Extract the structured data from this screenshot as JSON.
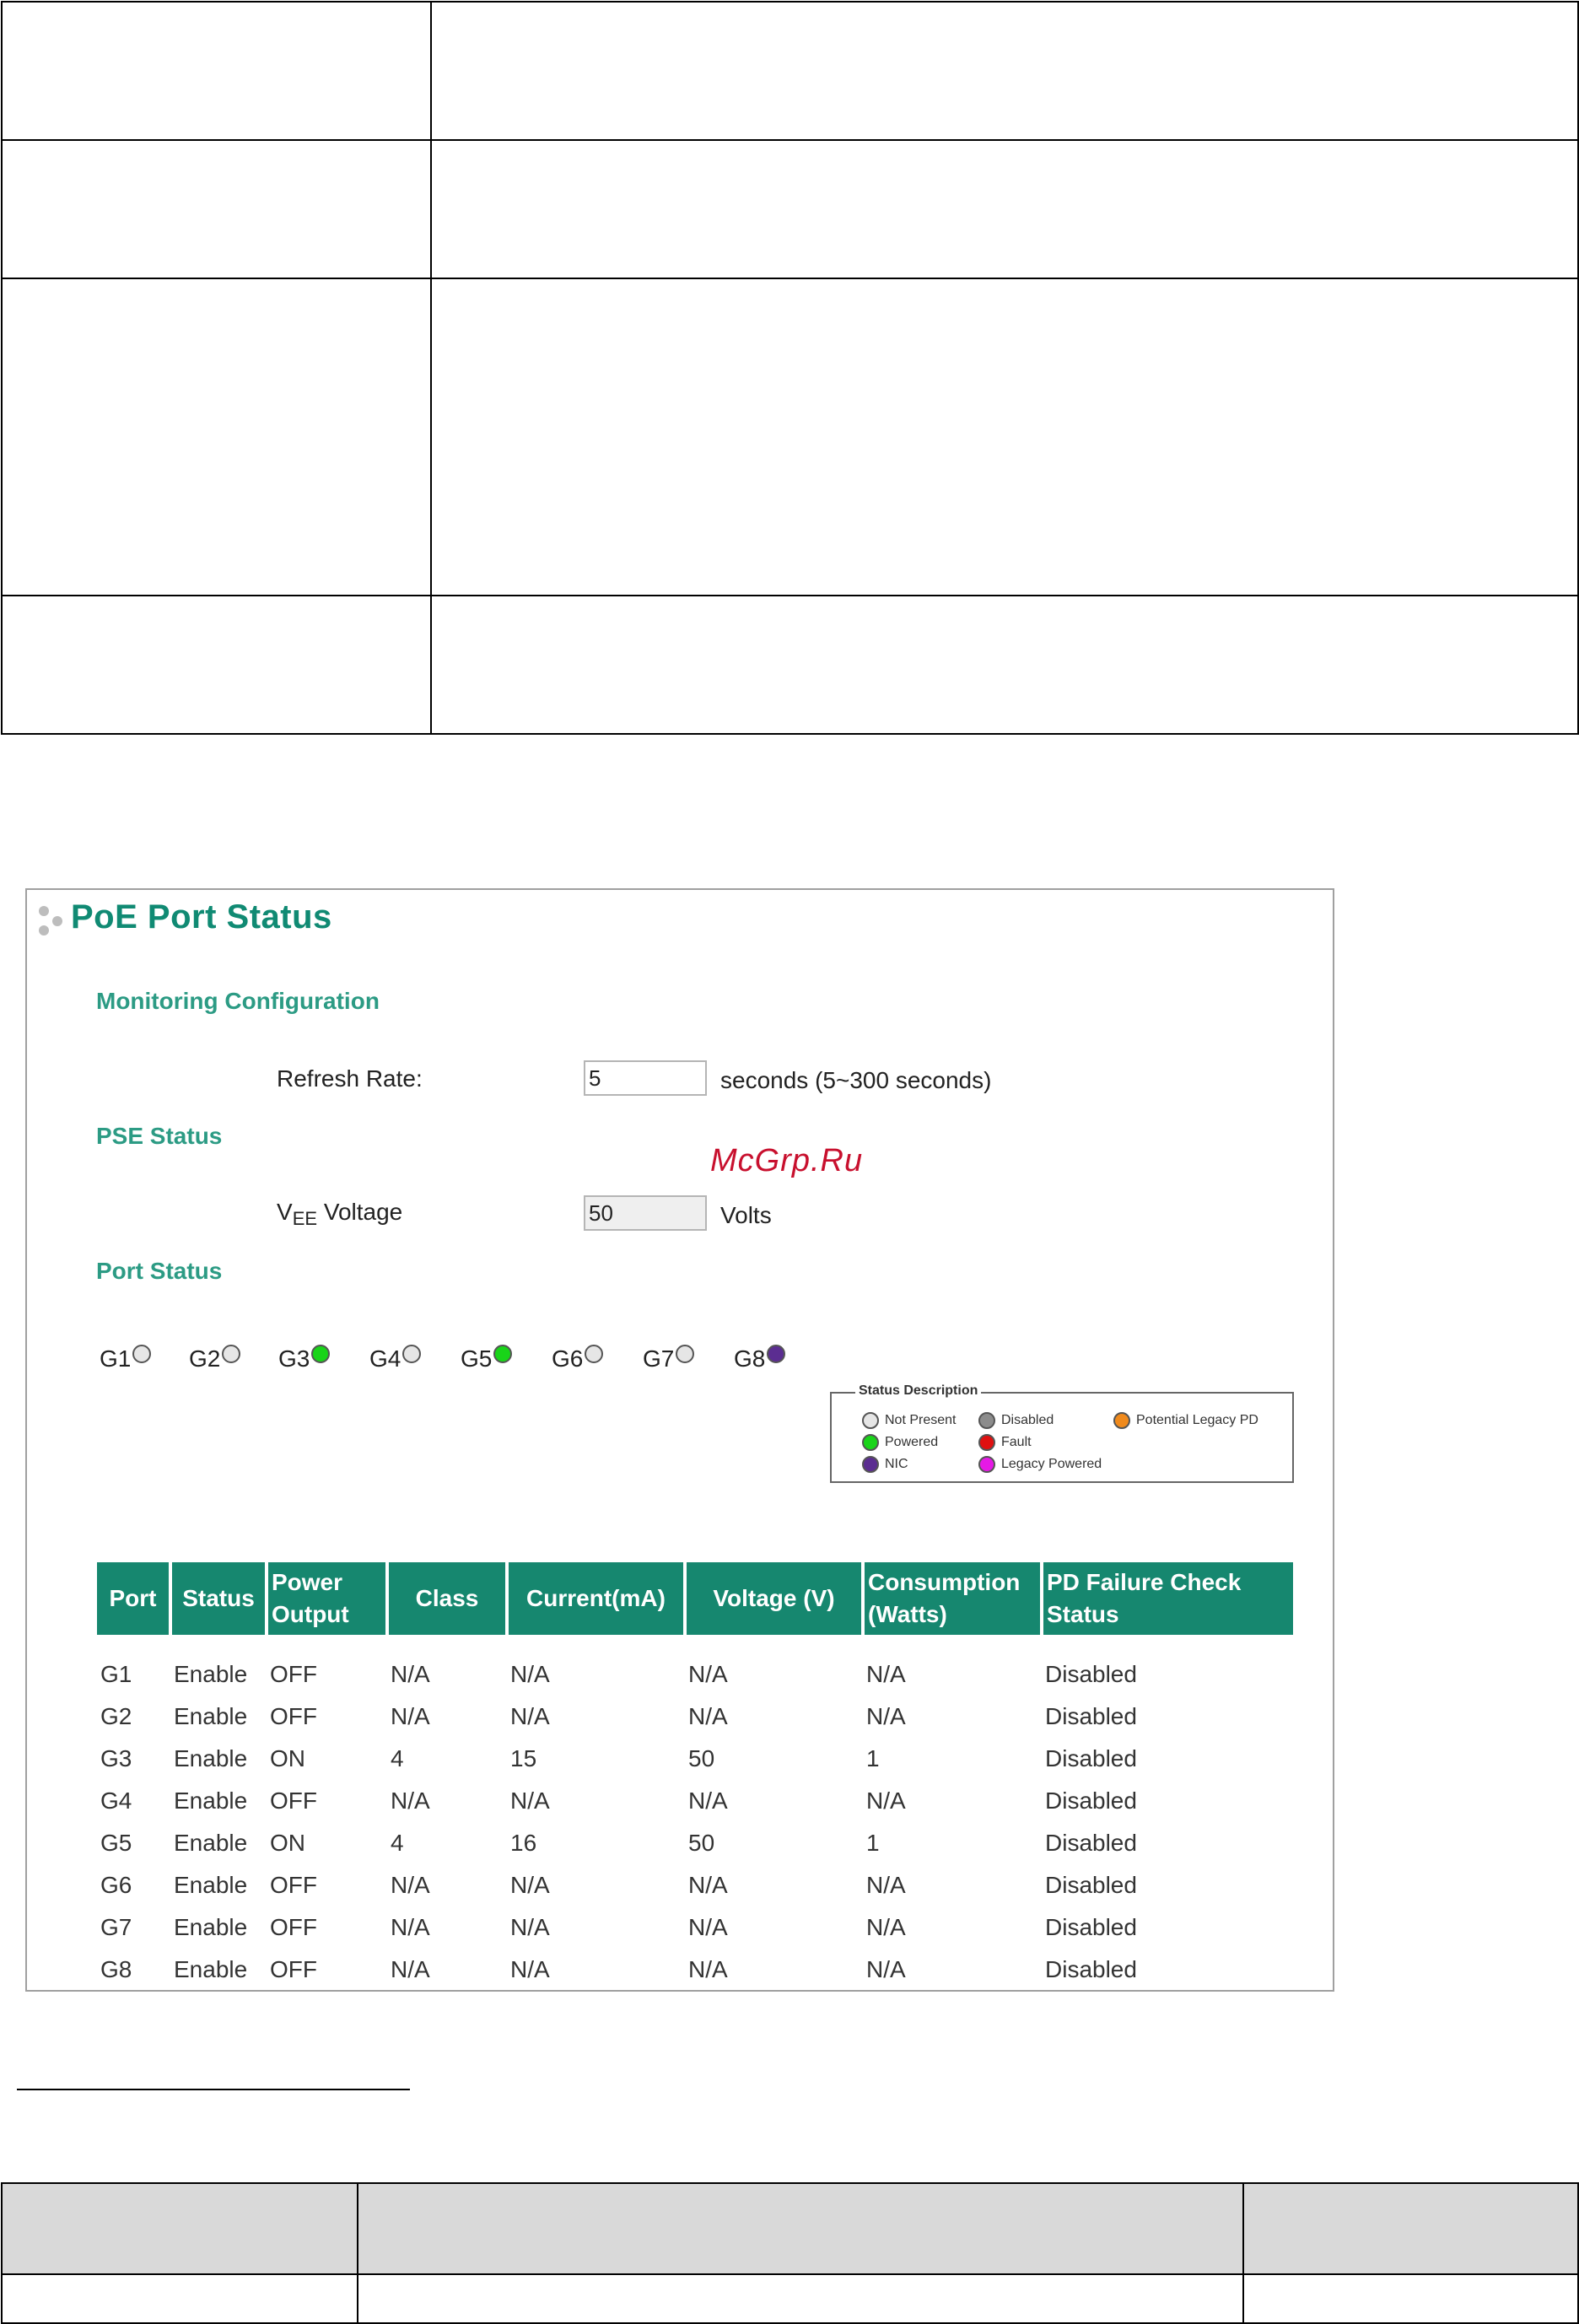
{
  "top_table": {
    "rows": [
      {
        "label": "",
        "description": ""
      },
      {
        "label": "",
        "description": ""
      },
      {
        "label": "",
        "description": ""
      },
      {
        "label": "",
        "description": ""
      }
    ]
  },
  "panel": {
    "title": "PoE Port Status",
    "monitoring": {
      "heading": "Monitoring Configuration",
      "refresh_label": "Refresh Rate:",
      "refresh_value": "5",
      "refresh_suffix": "seconds (5~300 seconds)"
    },
    "pse": {
      "heading": "PSE Status",
      "vee_label_main": "V",
      "vee_label_sub": "EE",
      "vee_label_rest": " Voltage",
      "vee_value": "50",
      "vee_suffix": "Volts"
    },
    "watermark": "McGrp.Ru",
    "port_status": {
      "heading": "Port Status",
      "ports": [
        {
          "label": "G1",
          "state": "not-present",
          "color": "#e6e6e6"
        },
        {
          "label": "G2",
          "state": "not-present",
          "color": "#e6e6e6"
        },
        {
          "label": "G3",
          "state": "powered",
          "color": "#19d419"
        },
        {
          "label": "G4",
          "state": "not-present",
          "color": "#e6e6e6"
        },
        {
          "label": "G5",
          "state": "powered",
          "color": "#19d419"
        },
        {
          "label": "G6",
          "state": "not-present",
          "color": "#e6e6e6"
        },
        {
          "label": "G7",
          "state": "not-present",
          "color": "#e6e6e6"
        },
        {
          "label": "G8",
          "state": "nic",
          "color": "#5b2d91"
        }
      ]
    },
    "legend": {
      "title": "Status Description",
      "items": [
        {
          "label": "Not Present",
          "color": "#e6e6e6"
        },
        {
          "label": "Disabled",
          "color": "#8c8c8c"
        },
        {
          "label": "Potential Legacy PD",
          "color": "#f08a1c"
        },
        {
          "label": "Powered",
          "color": "#19d419"
        },
        {
          "label": "Fault",
          "color": "#e01010"
        },
        {
          "label": "NIC",
          "color": "#5b2d91"
        },
        {
          "label": "Legacy Powered",
          "color": "#e619e6"
        }
      ]
    },
    "table": {
      "headers": [
        "Port",
        "Status",
        "Power Output",
        "Class",
        "Current(mA)",
        "Voltage (V)",
        "Consumption (Watts)",
        "PD Failure Check Status"
      ],
      "rows": [
        [
          "G1",
          "Enable",
          "OFF",
          "N/A",
          "N/A",
          "N/A",
          "N/A",
          "Disabled"
        ],
        [
          "G2",
          "Enable",
          "OFF",
          "N/A",
          "N/A",
          "N/A",
          "N/A",
          "Disabled"
        ],
        [
          "G3",
          "Enable",
          "ON",
          "4",
          "15",
          "50",
          "1",
          "Disabled"
        ],
        [
          "G4",
          "Enable",
          "OFF",
          "N/A",
          "N/A",
          "N/A",
          "N/A",
          "Disabled"
        ],
        [
          "G5",
          "Enable",
          "ON",
          "4",
          "16",
          "50",
          "1",
          "Disabled"
        ],
        [
          "G6",
          "Enable",
          "OFF",
          "N/A",
          "N/A",
          "N/A",
          "N/A",
          "Disabled"
        ],
        [
          "G7",
          "Enable",
          "OFF",
          "N/A",
          "N/A",
          "N/A",
          "N/A",
          "Disabled"
        ],
        [
          "G8",
          "Enable",
          "OFF",
          "N/A",
          "N/A",
          "N/A",
          "N/A",
          "Disabled"
        ]
      ]
    }
  },
  "bottom_table": {
    "header": [
      "",
      "",
      ""
    ],
    "row": [
      "",
      "",
      ""
    ]
  },
  "colors": {
    "accent_green": "#16876f",
    "section_green": "#2c9b84"
  }
}
